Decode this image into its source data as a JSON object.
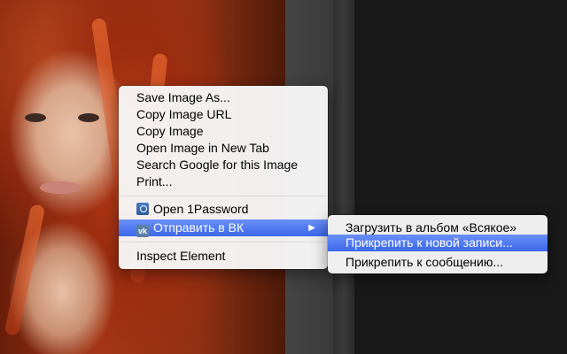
{
  "context_menu": {
    "items": [
      {
        "label": "Save Image As..."
      },
      {
        "label": "Copy Image URL"
      },
      {
        "label": "Copy Image"
      },
      {
        "label": "Open Image in New Tab"
      },
      {
        "label": "Search Google for this Image"
      },
      {
        "label": "Print..."
      }
    ],
    "extensions": [
      {
        "label": "Open 1Password",
        "icon": "1password-icon"
      },
      {
        "label": "Отправить в ВК",
        "icon": "vk-icon",
        "icon_text": "vk",
        "highlighted": true,
        "has_submenu": true
      }
    ],
    "inspect_label": "Inspect Element",
    "submenu_arrow": "▶"
  },
  "submenu": {
    "items": [
      {
        "label": "Загрузить в альбом «Всякое»"
      },
      {
        "label": "Прикрепить к новой записи...",
        "highlighted": true
      },
      {
        "label": "Прикрепить к сообщению..."
      }
    ]
  },
  "colors": {
    "highlight": "#3b68ec",
    "menu_background": "#f6f6f6"
  }
}
